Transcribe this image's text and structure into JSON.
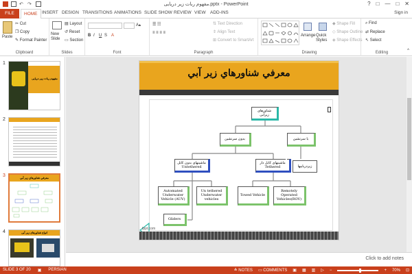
{
  "window": {
    "title": "مفهوم ربات زیر دریایی.pptx - PowerPoint",
    "controls": [
      "?",
      "□",
      "—",
      "□",
      "✕"
    ]
  },
  "tabs": {
    "file": "FILE",
    "items": [
      "HOME",
      "INSERT",
      "DESIGN",
      "TRANSITIONS",
      "ANIMATIONS",
      "SLIDE SHOW",
      "REVIEW",
      "VIEW",
      "ADD-INS"
    ],
    "sign_in": "Sign in"
  },
  "ribbon": {
    "clipboard": {
      "paste": "Paste",
      "cut": "Cut",
      "copy": "Copy",
      "format_painter": "Format Painter",
      "label": "Clipboard"
    },
    "slides": {
      "new_slide": "New Slide",
      "layout": "Layout",
      "reset": "Reset",
      "section": "Section",
      "label": "Slides"
    },
    "font": {
      "label": "Font"
    },
    "paragraph": {
      "text_direction": "Text Direction",
      "align_text": "Align Text",
      "convert_smartart": "Convert to SmartArt",
      "label": "Paragraph"
    },
    "drawing": {
      "arrange": "Arrange",
      "quick_styles": "Quick Styles",
      "shape_fill": "Shape Fill",
      "shape_outline": "Shape Outline",
      "shape_effects": "Shape Effects",
      "label": "Drawing"
    },
    "editing": {
      "find": "Find",
      "replace": "Replace",
      "select": "Select",
      "label": "Editing"
    }
  },
  "thumbnails": {
    "numbers": [
      "1",
      "2",
      "3",
      "4"
    ],
    "slide1_title": "مفهوم ربات زیر دریایی",
    "slide3_title": "معرفي شناورهاي زير آبي",
    "slide4_title": "انواع شناورهای زیر آبی"
  },
  "slide": {
    "title": "معرفي شناورهاي زير آبي",
    "footer": "fppt.com",
    "nodes": {
      "root": "شناورهای زیرآبی",
      "manned": "بدون سرنشین",
      "crewed": "با سرنشین",
      "untethered": "ماشینهای بدون کابل Untethered",
      "tethered": "ماشینهای کابل دار Tethered",
      "submarine": "زیردریاییها",
      "auv": "Automated Underwater Vehicle (AUV)",
      "uuv": "Un tethered Underwater vehicles",
      "towed": "Towed Vehicle",
      "rov": "Remotely Operated Vehicles(ROV)",
      "gliders": "Gliders"
    }
  },
  "notes": {
    "placeholder": "Click to add notes"
  },
  "status": {
    "slide_of": "SLIDE 3 OF 20",
    "language": "PERSIAN",
    "notes": "NOTES",
    "comments": "COMMENTS",
    "zoom": "70%"
  }
}
